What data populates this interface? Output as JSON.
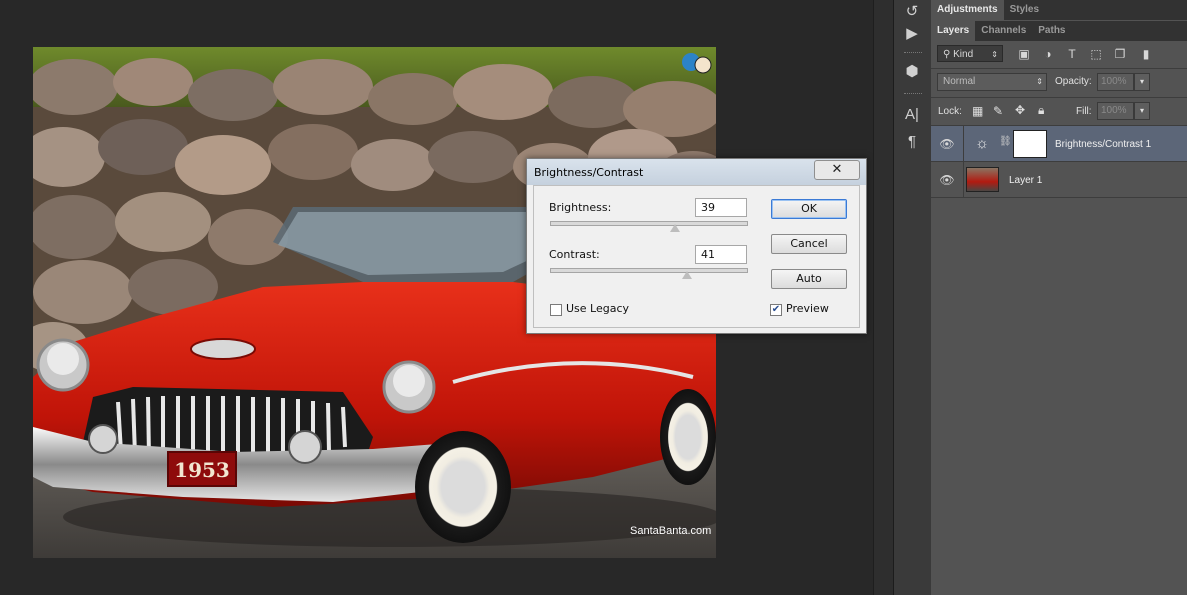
{
  "panel_tabs_top": [
    {
      "label": "Adjustments",
      "active": true
    },
    {
      "label": "Styles",
      "active": false
    }
  ],
  "panel_tabs_layers": [
    {
      "label": "Layers",
      "active": true
    },
    {
      "label": "Channels",
      "active": false
    },
    {
      "label": "Paths",
      "active": false
    }
  ],
  "layers_panel": {
    "kind_filter": "Kind",
    "blend_mode": "Normal",
    "opacity_label": "Opacity:",
    "opacity_value": "100%",
    "lock_label": "Lock:",
    "fill_label": "Fill:",
    "fill_value": "100%",
    "layers": [
      {
        "name": "Brightness/Contrast 1",
        "selected": true
      },
      {
        "name": "Layer 1",
        "selected": false
      }
    ]
  },
  "photo": {
    "plate_text": "1953",
    "watermark": "SantaBanta.com"
  },
  "dialog": {
    "title": "Brightness/Contrast",
    "close_label": "✕",
    "brightness_label": "Brightness:",
    "brightness_value": "39",
    "brightness_level": 0.64,
    "contrast_label": "Contrast:",
    "contrast_value": "41",
    "contrast_level": 0.7,
    "ok_label": "OK",
    "cancel_label": "Cancel",
    "auto_label": "Auto",
    "use_legacy_label": "Use Legacy",
    "use_legacy_checked": false,
    "preview_label": "Preview",
    "preview_checked": true
  },
  "icons": [
    "history-icon",
    "play-action-icon",
    "3d-cube-icon",
    "character-icon",
    "paragraph-icon",
    "eye-icon",
    "search-icon",
    "link-icon"
  ]
}
